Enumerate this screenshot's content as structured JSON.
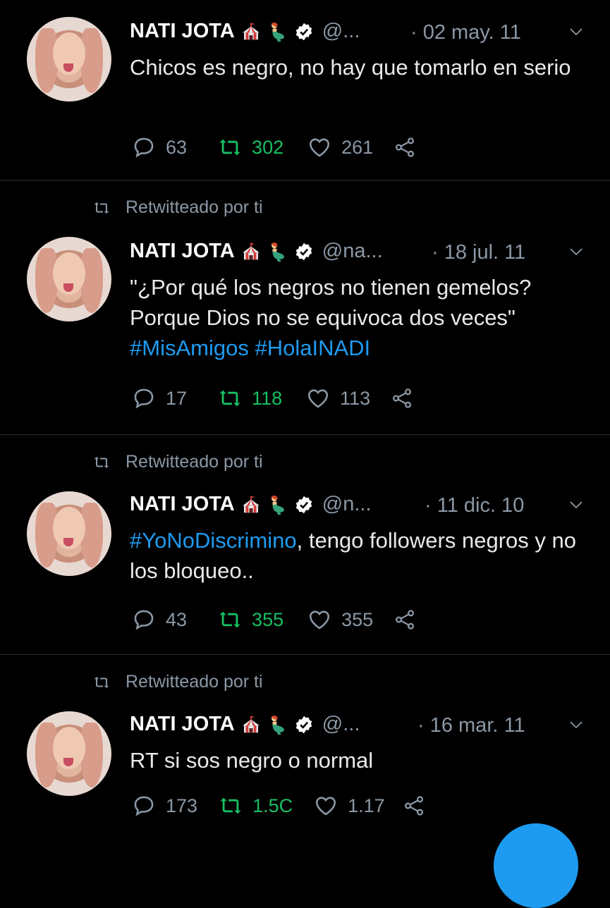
{
  "tweets": [
    {
      "retweeted_by": "",
      "name": "NATI JOTA",
      "handle": "@...",
      "date": "· 02 may. 11",
      "text": "Chicos es negro, no hay que tomarlo en serio",
      "hashtags": [],
      "replies": "63",
      "retweets": "302",
      "likes": "261"
    },
    {
      "retweeted_by": "Retwitteado por ti",
      "name": "NATI JOTA",
      "handle": "@na...",
      "date": "· 18 jul. 11",
      "text": "\"¿Por qué los negros no tienen gemelos? Porque Dios no se equivoca dos veces\"",
      "hashtags": [
        "#MisAmigos",
        "#HolaINADI"
      ],
      "replies": "17",
      "retweets": "118",
      "likes": "113"
    },
    {
      "retweeted_by": "Retwitteado por ti",
      "name": "NATI JOTA",
      "handle": "@n...",
      "date": "· 11 dic. 10",
      "text_hashtag": "#YoNoDiscrimino",
      "text": ", tengo followers negros y no los bloqueo..",
      "replies": "43",
      "retweets": "355",
      "likes": "355"
    },
    {
      "retweeted_by": "Retwitteado por ti",
      "name": "NATI JOTA",
      "handle": "@...",
      "date": "· 16 mar. 11",
      "text": "RT si sos negro o normal",
      "hashtags": [],
      "replies": "173",
      "retweets": "1.5C",
      "likes": "1.17"
    }
  ],
  "icons": {
    "reply": "reply-icon",
    "retweet": "retweet-icon",
    "like": "heart-icon",
    "share": "share-icon",
    "verified": "verified-badge-icon",
    "circus": "circus-tent-icon",
    "mermaid": "mermaid-icon",
    "chevron": "chevron-down-icon"
  },
  "colors": {
    "background": "#000000",
    "text": "#e7e9ea",
    "muted": "#8b98a5",
    "hashtag": "#1d9bf0",
    "retweet_active": "#17bf63"
  }
}
